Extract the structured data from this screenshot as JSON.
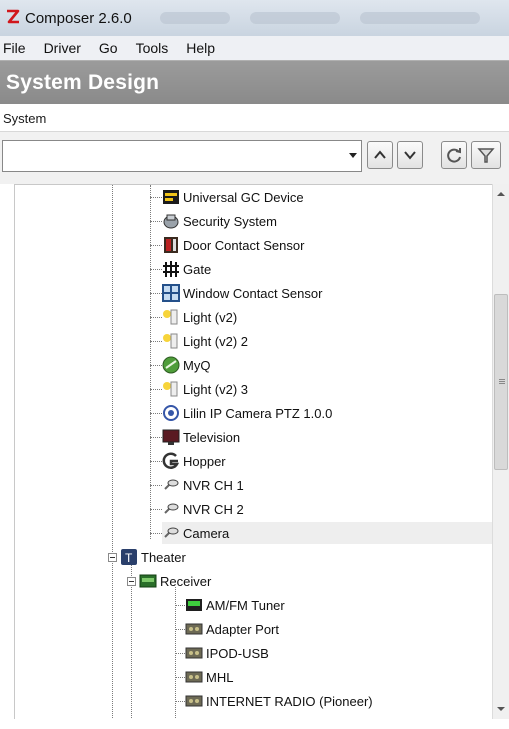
{
  "window": {
    "title": "Composer 2.6.0"
  },
  "menu": [
    "File",
    "Driver",
    "Go",
    "Tools",
    "Help"
  ],
  "section": {
    "title": "System Design"
  },
  "subheader": {
    "label": "System"
  },
  "toolbar": {
    "combo_value": ""
  },
  "tree": {
    "items": [
      {
        "label": "Universal GC Device",
        "icon": "universal-gc-device-icon"
      },
      {
        "label": "Security System",
        "icon": "security-system-icon"
      },
      {
        "label": "Door Contact Sensor",
        "icon": "door-contact-sensor-icon"
      },
      {
        "label": "Gate",
        "icon": "gate-icon"
      },
      {
        "label": "Window Contact Sensor",
        "icon": "window-contact-sensor-icon"
      },
      {
        "label": "Light (v2)",
        "icon": "light-icon"
      },
      {
        "label": "Light (v2) 2",
        "icon": "light-icon"
      },
      {
        "label": "MyQ",
        "icon": "myq-icon"
      },
      {
        "label": "Light (v2) 3",
        "icon": "light-icon"
      },
      {
        "label": "Lilin IP Camera PTZ 1.0.0",
        "icon": "ip-camera-icon"
      },
      {
        "label": "Television",
        "icon": "television-icon"
      },
      {
        "label": "Hopper",
        "icon": "hopper-icon"
      },
      {
        "label": "NVR CH 1",
        "icon": "camera-icon"
      },
      {
        "label": "NVR CH 2",
        "icon": "camera-icon"
      },
      {
        "label": "Camera",
        "icon": "camera-icon"
      },
      {
        "label": "Theater",
        "icon": "room-icon"
      },
      {
        "label": "Receiver",
        "icon": "receiver-icon"
      },
      {
        "label": "AM/FM Tuner",
        "icon": "tuner-icon"
      },
      {
        "label": "Adapter Port",
        "icon": "port-icon"
      },
      {
        "label": "IPOD-USB",
        "icon": "port-icon"
      },
      {
        "label": "MHL",
        "icon": "port-icon"
      },
      {
        "label": "INTERNET RADIO (Pioneer)",
        "icon": "port-icon"
      }
    ]
  },
  "colors": {
    "header_bg": "#8f8f8f",
    "selection": "#eeeeee"
  }
}
